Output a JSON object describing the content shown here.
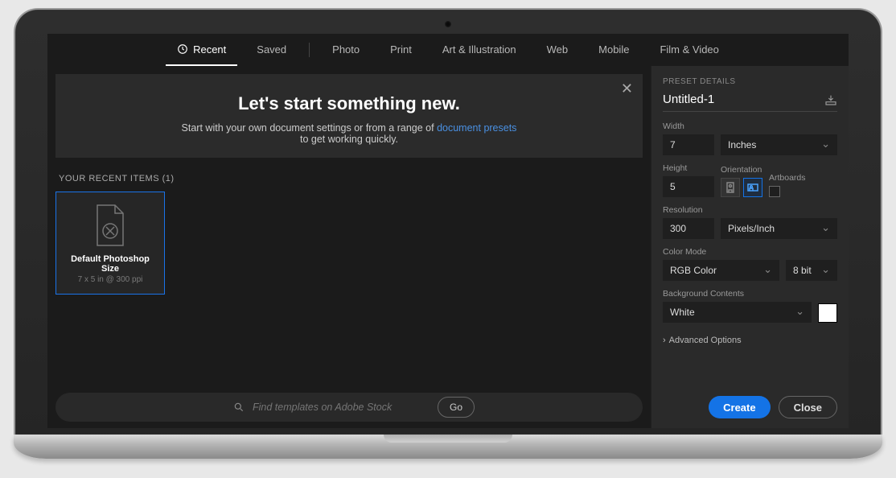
{
  "tabs": {
    "recent": "Recent",
    "saved": "Saved",
    "photo": "Photo",
    "print": "Print",
    "art": "Art & Illustration",
    "web": "Web",
    "mobile": "Mobile",
    "film": "Film & Video"
  },
  "hero": {
    "title": "Let's start something new.",
    "sub_prefix": "Start with your own document settings or from a range of",
    "sub_link": "document presets",
    "sub_suffix": "to get working quickly."
  },
  "recent": {
    "label": "YOUR RECENT ITEMS  (1)",
    "items": [
      {
        "name": "Default Photoshop Size",
        "dims": "7 x 5 in @ 300 ppi"
      }
    ]
  },
  "search": {
    "placeholder": "Find templates on Adobe Stock",
    "go": "Go"
  },
  "sidebar": {
    "header": "PRESET DETAILS",
    "doc_name": "Untitled-1",
    "width_label": "Width",
    "width_value": "7",
    "units": "Inches",
    "height_label": "Height",
    "height_value": "5",
    "orientation_label": "Orientation",
    "artboards_label": "Artboards",
    "resolution_label": "Resolution",
    "resolution_value": "300",
    "resolution_units": "Pixels/Inch",
    "color_mode_label": "Color Mode",
    "color_mode": "RGB Color",
    "bit_depth": "8 bit",
    "bg_label": "Background Contents",
    "bg_value": "White",
    "advanced": "Advanced Options",
    "create": "Create",
    "close": "Close"
  }
}
